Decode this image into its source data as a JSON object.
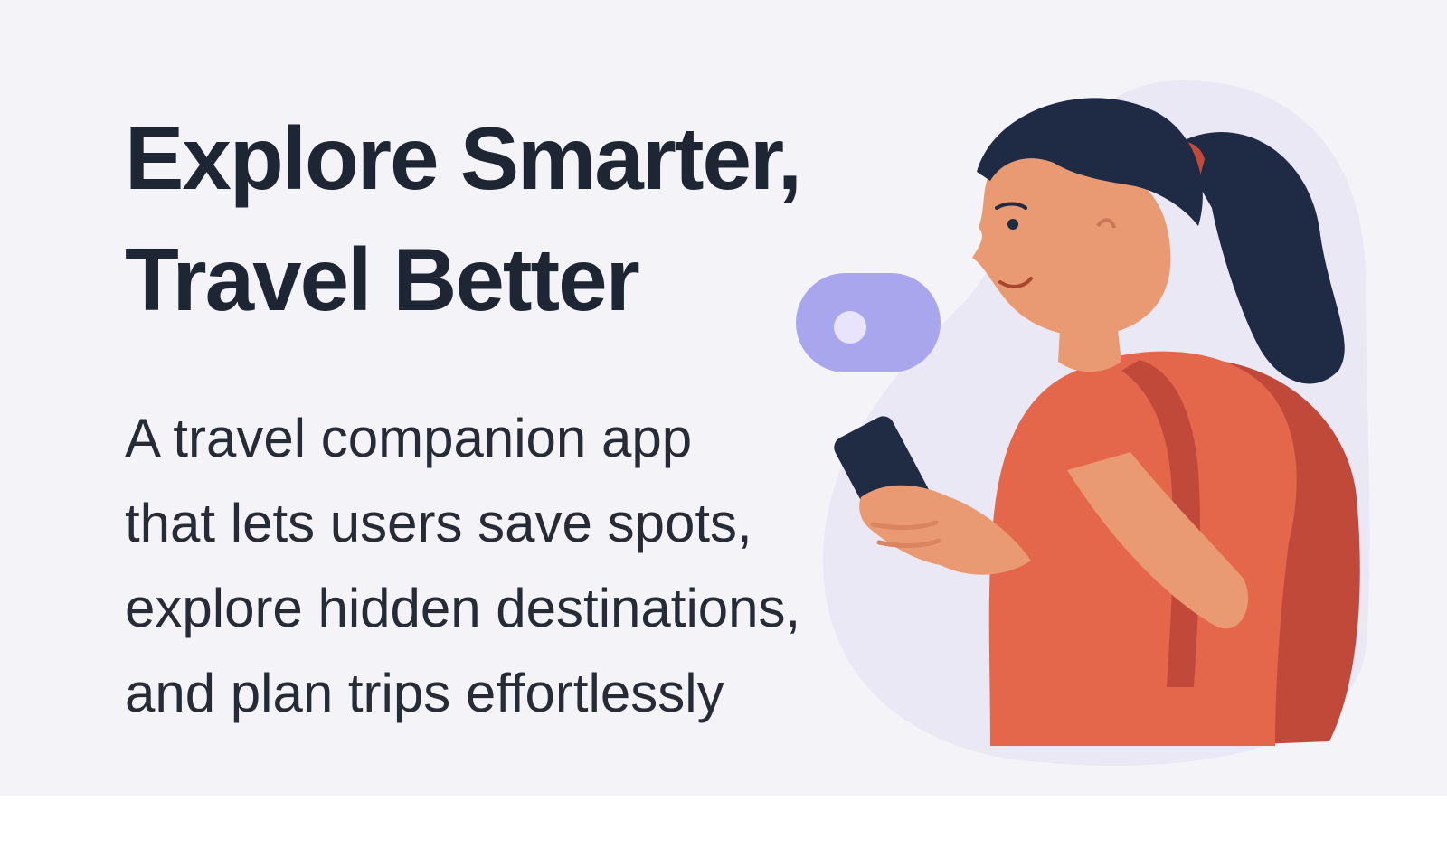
{
  "hero": {
    "headline_lines": [
      "Explore Smarter,",
      "Travel Better"
    ],
    "subtext_lines": [
      "A travel companion app",
      "that lets users save spots,",
      "explore hidden destinations,",
      "and plan trips effortlessly"
    ]
  },
  "illustration": {
    "subject_icon": "traveler-with-phone-icon",
    "bubble_icon": "notification-bubble-icon"
  },
  "colors": {
    "background": "#f3f3f8",
    "heading_text": "#1e2533",
    "body_text": "#262b35",
    "accent_bubble": "#a9a6ee",
    "shirt": "#e4664b",
    "backpack": "#c0493a",
    "hair": "#1f2a44",
    "skin": "#e99a72",
    "phone": "#1f2c44"
  }
}
